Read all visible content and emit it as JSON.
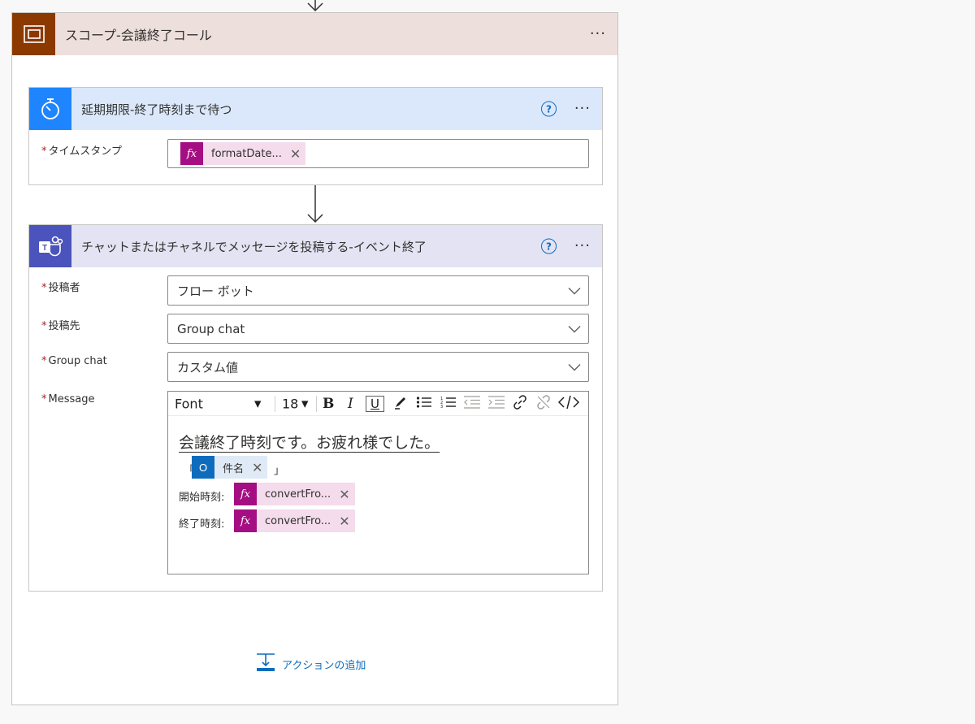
{
  "scope": {
    "title": "スコープ-会議終了コール",
    "more": "···"
  },
  "delay": {
    "title": "延期期限-終了時刻まで待つ",
    "help": "?",
    "more": "···",
    "timestamp_label": "タイムスタンプ",
    "timestamp_token": "formatDate...",
    "token_close": "✕"
  },
  "teams": {
    "title": "チャットまたはチャネルでメッセージを投稿する-イベント終了",
    "help": "?",
    "more": "···",
    "poster_label": "投稿者",
    "poster_value": "フロー ボット",
    "post_in_label": "投稿先",
    "post_in_value": "Group chat",
    "group_chat_label": "Group chat",
    "group_chat_value": "カスタム値",
    "message_label": "Message",
    "toolbar": {
      "font": "Font",
      "font_caret": "▼",
      "size": "18",
      "size_caret": "▼",
      "bold": "B",
      "italic": "I",
      "underline": "U"
    },
    "message": {
      "line1": "会議終了時刻です。お疲れ様でした。",
      "quote_open": "「",
      "subject_token": "件名",
      "quote_close": "」",
      "start_label": "開始時刻:",
      "start_token": "convertFro...",
      "end_label": "終了時刻:",
      "end_token": "convertFro...",
      "token_close": "✕"
    }
  },
  "required_mark": "*",
  "fx": "fx",
  "outlook_glyph": "O",
  "add_action": "アクションの追加",
  "colors": {
    "scope_header": "#eddfdb",
    "scope_icon": "#8c3900",
    "delay_header": "#dbe8fb",
    "delay_icon": "#1f85ff",
    "teams_header": "#e3e3f3",
    "teams_icon": "#4b53bc",
    "fx_token": "#a50e82",
    "link": "#0f6cbd"
  }
}
